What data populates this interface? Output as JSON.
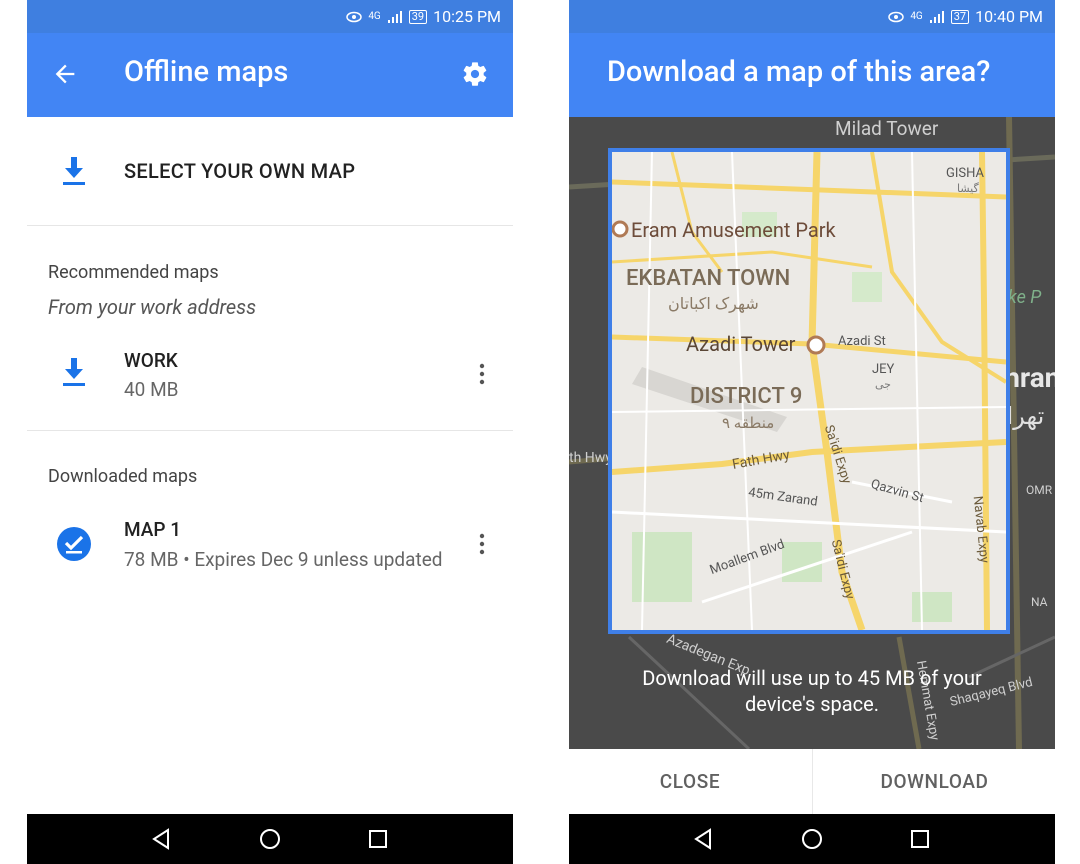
{
  "left": {
    "status": {
      "network": "4G",
      "battery": "39",
      "time": "10:25 PM"
    },
    "appbar": {
      "title": "Offline maps"
    },
    "select_own_map": {
      "label": "SELECT YOUR OWN MAP"
    },
    "recommended": {
      "header": "Recommended maps",
      "subheader": "From your work address",
      "item": {
        "title": "WORK",
        "size": "40 MB"
      }
    },
    "downloaded": {
      "header": "Downloaded maps",
      "item": {
        "title": "MAP 1",
        "detail": "78 MB • Expires Dec 9 unless updated"
      }
    }
  },
  "right": {
    "status": {
      "network": "4G",
      "battery": "37",
      "time": "10:40 PM"
    },
    "appbar": {
      "title": "Download a map of this area?"
    },
    "map": {
      "outside_labels": {
        "top": "Milad Tower",
        "right_city": "Tehran",
        "right_city_fa": "تهران",
        "lake": "Lake P",
        "left_hwy": "th Hwy",
        "azadegan": "Azadegan Exp",
        "shaqayeq": "Shaqayeq Blvd",
        "hemat": "Hemmat Expy",
        "right_small": "OMR",
        "right_na": "NA"
      },
      "inside_labels": {
        "gisha": "GISHA",
        "gisha_fa": "گیشا",
        "eram": "Eram Amusement Park",
        "ekbatan": "EKBATAN TOWN",
        "ekbatan_fa": "شهرک اکباتان",
        "azadi_tower": "Azadi Tower",
        "azadi_st": "Azadi St",
        "jey": "JEY",
        "jey_fa": "جی",
        "district9": "DISTRICT 9",
        "district9_fa": "منطقه ۹",
        "fath": "Fath Hwy",
        "saidi_top": "Sa'idi Expy",
        "qazvin": "Qazvin St",
        "zarand": "45m Zarand",
        "navab": "Navab Expy",
        "moallem": "Moallem Blvd",
        "saidi_bottom": "Sa'idi Expy"
      }
    },
    "note": {
      "line1": "Download will use up to 45 MB of your",
      "line2": "device's space."
    },
    "actions": {
      "close": "CLOSE",
      "download": "DOWNLOAD"
    }
  },
  "colors": {
    "primary": "#4285f4",
    "status": "#3f7fe0",
    "accent_border": "#3f7fe8",
    "scrim": "#4a4a4a"
  },
  "icons": [
    "back-arrow-icon",
    "gear-icon",
    "download-icon",
    "check-circle-icon",
    "more-vert-icon",
    "nav-back-icon",
    "nav-home-icon",
    "nav-recents-icon"
  ]
}
